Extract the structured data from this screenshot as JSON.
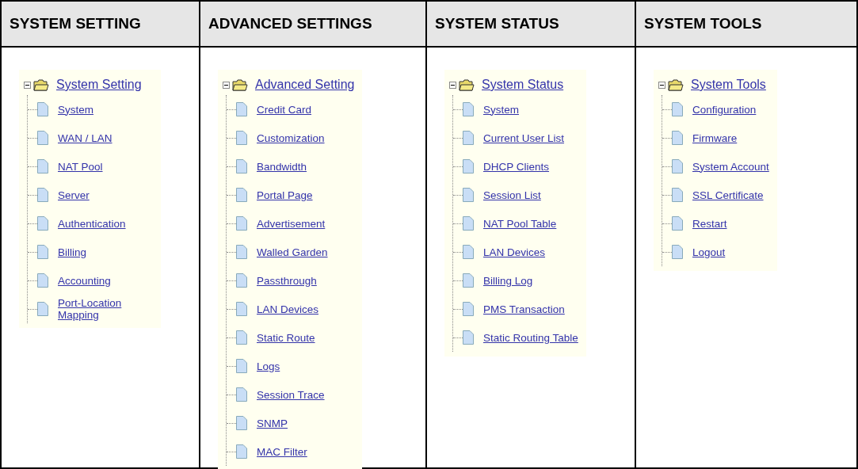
{
  "columns": [
    {
      "heading": "SYSTEM SETTING",
      "tree": {
        "label": "System Setting",
        "expanded": true,
        "children": [
          {
            "label": "System"
          },
          {
            "label": "WAN / LAN"
          },
          {
            "label": "NAT Pool"
          },
          {
            "label": "Server"
          },
          {
            "label": "Authentication"
          },
          {
            "label": "Billing"
          },
          {
            "label": "Accounting"
          },
          {
            "label": "Port-Location Mapping"
          }
        ]
      }
    },
    {
      "heading": "ADVANCED SETTINGS",
      "tree": {
        "label": "Advanced Setting",
        "expanded": true,
        "children": [
          {
            "label": "Credit Card"
          },
          {
            "label": "Customization"
          },
          {
            "label": "Bandwidth"
          },
          {
            "label": "Portal Page"
          },
          {
            "label": "Advertisement"
          },
          {
            "label": "Walled Garden"
          },
          {
            "label": "Passthrough"
          },
          {
            "label": "LAN Devices"
          },
          {
            "label": "Static Route"
          },
          {
            "label": "Logs"
          },
          {
            "label": "Session Trace"
          },
          {
            "label": "SNMP"
          },
          {
            "label": "MAC Filter"
          }
        ]
      }
    },
    {
      "heading": "SYSTEM STATUS",
      "tree": {
        "label": "System Status",
        "expanded": true,
        "children": [
          {
            "label": "System"
          },
          {
            "label": "Current User List"
          },
          {
            "label": "DHCP Clients"
          },
          {
            "label": "Session List"
          },
          {
            "label": "NAT Pool Table"
          },
          {
            "label": "LAN Devices"
          },
          {
            "label": "Billing Log"
          },
          {
            "label": "PMS Transaction"
          },
          {
            "label": "Static Routing Table"
          }
        ]
      }
    },
    {
      "heading": "SYSTEM TOOLS",
      "tree": {
        "label": "System Tools",
        "expanded": true,
        "children": [
          {
            "label": "Configuration"
          },
          {
            "label": "Firmware"
          },
          {
            "label": "System Account"
          },
          {
            "label": "SSL Certificate"
          },
          {
            "label": "Restart"
          },
          {
            "label": "Logout"
          }
        ]
      }
    }
  ]
}
